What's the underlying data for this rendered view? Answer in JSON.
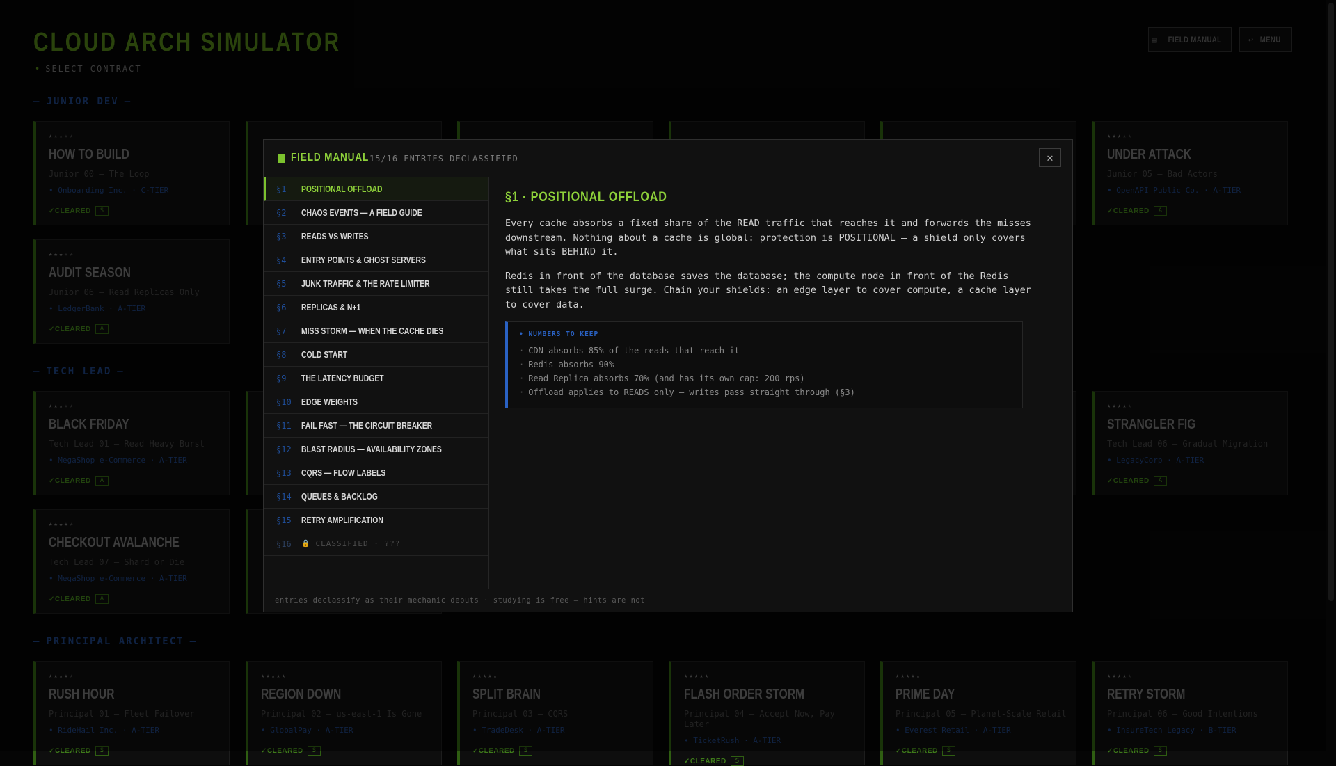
{
  "header": {
    "title": "CLOUD ARCH SIMULATOR",
    "subtitle": "SELECT CONTRACT",
    "field_manual_btn": "FIELD MANUAL",
    "menu_btn": "MENU"
  },
  "sections": {
    "junior": "JUNIOR DEV",
    "tech": "TECH LEAD",
    "principal": "PRINCIPAL ARCHITECT"
  },
  "cards": {
    "c1": {
      "name": "HOW TO BUILD",
      "sub": "Junior 00 — The Loop",
      "client": "Onboarding Inc.",
      "tier": "C-TIER",
      "cleared": "CLEARED",
      "grade": "S",
      "stars": 1
    },
    "c6": {
      "name": "UNDER ATTACK",
      "sub": "Junior 05 — Bad Actors",
      "client": "OpenAPI Public Co.",
      "tier": "A-TIER",
      "cleared": "CLEARED",
      "grade": "A",
      "stars": 3
    },
    "c7": {
      "name": "AUDIT SEASON",
      "sub": "Junior 06 — Read Replicas Only",
      "client": "LedgerBank",
      "tier": "A-TIER",
      "cleared": "CLEARED",
      "grade": "A",
      "stars": 3
    },
    "t1": {
      "name": "BLACK FRIDAY",
      "sub": "Tech Lead 01 — Read Heavy Burst",
      "client": "MegaShop e-Commerce",
      "tier": "A-TIER",
      "cleared": "CLEARED",
      "grade": "A",
      "stars": 3
    },
    "t6": {
      "name": "STRANGLER FIG",
      "sub": "Tech Lead 06 — Gradual Migration",
      "client": "LegacyCorp",
      "tier": "A-TIER",
      "cleared": "CLEARED",
      "grade": "A",
      "stars": 4
    },
    "t7": {
      "name": "CHECKOUT AVALANCHE",
      "sub": "Tech Lead 07 — Shard or Die",
      "client": "MegaShop e-Commerce",
      "tier": "A-TIER",
      "cleared": "CLEARED",
      "grade": "A",
      "stars": 4
    },
    "p1": {
      "name": "RUSH HOUR",
      "sub": "Principal 01 — Fleet Failover",
      "client": "RideHail Inc.",
      "tier": "A-TIER",
      "cleared": "CLEARED",
      "grade": "S",
      "stars": 4
    },
    "p2": {
      "name": "REGION DOWN",
      "sub": "Principal 02 — us-east-1 Is Gone",
      "client": "GlobalPay",
      "tier": "A-TIER",
      "cleared": "CLEARED",
      "grade": "S",
      "stars": 5
    },
    "p3": {
      "name": "SPLIT BRAIN",
      "sub": "Principal 03 — CQRS",
      "client": "TradeDesk",
      "tier": "A-TIER",
      "cleared": "CLEARED",
      "grade": "S",
      "stars": 5
    },
    "p4": {
      "name": "FLASH ORDER STORM",
      "sub": "Principal 04 — Accept Now, Pay Later",
      "client": "TicketRush",
      "tier": "A-TIER",
      "cleared": "CLEARED",
      "grade": "S",
      "stars": 5
    },
    "p5": {
      "name": "PRIME DAY",
      "sub": "Principal 05 — Planet-Scale Retail",
      "client": "Everest Retail",
      "tier": "A-TIER",
      "cleared": "CLEARED",
      "grade": "S",
      "stars": 5
    },
    "p6": {
      "name": "RETRY STORM",
      "sub": "Principal 06 — Good Intentions",
      "client": "InsureTech Legacy",
      "tier": "B-TIER",
      "cleared": "CLEARED",
      "grade": "S",
      "stars": 4
    }
  },
  "modal": {
    "title": "FIELD MANUAL",
    "count": "15/16 ENTRIES DECLASSIFIED",
    "close": "✕",
    "toc": [
      {
        "num": "§1",
        "label": "POSITIONAL OFFLOAD"
      },
      {
        "num": "§2",
        "label": "CHAOS EVENTS — A FIELD GUIDE"
      },
      {
        "num": "§3",
        "label": "READS VS WRITES"
      },
      {
        "num": "§4",
        "label": "ENTRY POINTS & GHOST SERVERS"
      },
      {
        "num": "§5",
        "label": "JUNK TRAFFIC & THE RATE LIMITER"
      },
      {
        "num": "§6",
        "label": "REPLICAS & N+1"
      },
      {
        "num": "§7",
        "label": "MISS STORM — WHEN THE CACHE DIES"
      },
      {
        "num": "§8",
        "label": "COLD START"
      },
      {
        "num": "§9",
        "label": "THE LATENCY BUDGET"
      },
      {
        "num": "§10",
        "label": "EDGE WEIGHTS"
      },
      {
        "num": "§11",
        "label": "FAIL FAST — THE CIRCUIT BREAKER"
      },
      {
        "num": "§12",
        "label": "BLAST RADIUS — AVAILABILITY ZONES"
      },
      {
        "num": "§13",
        "label": "CQRS — FLOW LABELS"
      },
      {
        "num": "§14",
        "label": "QUEUES & BACKLOG"
      },
      {
        "num": "§15",
        "label": "RETRY AMPLIFICATION"
      },
      {
        "num": "§16",
        "label": "CLASSIFIED · ???"
      }
    ],
    "entry_title": "§1 · POSITIONAL OFFLOAD",
    "para1": "Every cache absorbs a fixed share of the READ traffic that reaches it and forwards the misses downstream. Nothing about a cache is global: protection is POSITIONAL — a shield only covers what sits BEHIND it.",
    "para2": "Redis in front of the database saves the database; the compute node in front of the Redis still takes the full surge. Chain your shields: an edge layer to cover compute, a cache layer to cover data.",
    "keep_title": "NUMBERS TO KEEP",
    "keep": [
      "CDN absorbs 85% of the reads that reach it",
      "Redis absorbs 90%",
      "Read Replica absorbs 70% (and has its own cap: 200 rps)",
      "Offload applies to READS only — writes pass straight through (§3)"
    ],
    "footer": "entries declassify as their mechanic debuts · studying is free — hints are not"
  }
}
